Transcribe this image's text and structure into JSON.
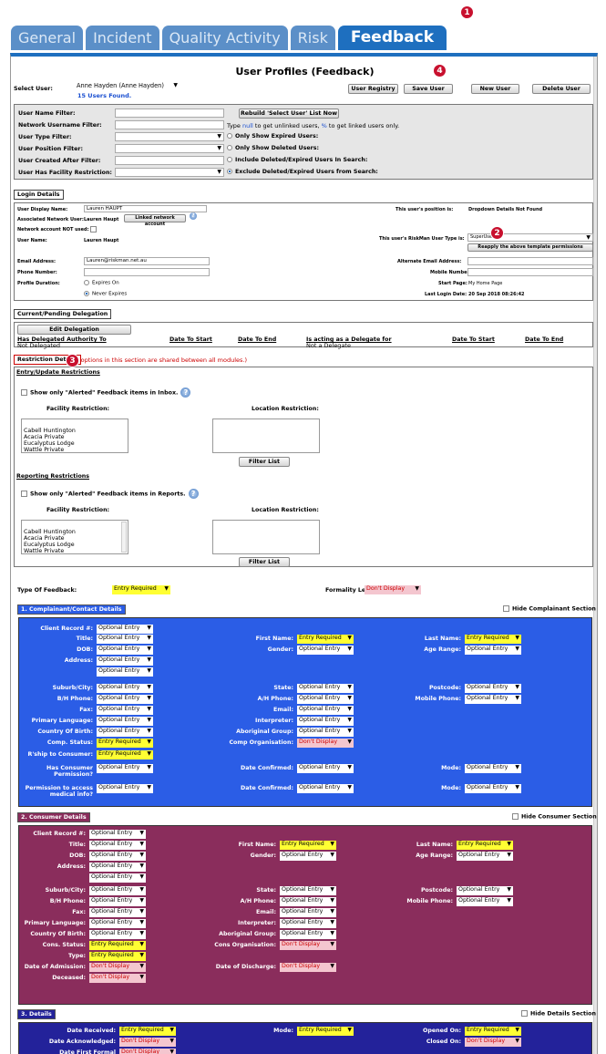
{
  "tabs": [
    {
      "label": "General"
    },
    {
      "label": "Incident"
    },
    {
      "label": "Quality Activity"
    },
    {
      "label": "Risk"
    },
    {
      "label": "Feedback"
    }
  ],
  "markers": {
    "m1": "1",
    "m2": "2",
    "m3": "3",
    "m4": "4"
  },
  "page_title": "User Profiles (Feedback)",
  "select_user": {
    "label": "Select User:",
    "value": "Anne Hayden (Anne Hayden)",
    "found": "15 Users Found."
  },
  "toolbar": {
    "registry": "User Registry",
    "save": "Save User",
    "new": "New User",
    "delete": "Delete User"
  },
  "filters": {
    "name": "User Name Filter:",
    "network": "Network Username Filter:",
    "type": "User Type Filter:",
    "position": "User Position Filter:",
    "created": "User Created After Filter:",
    "facility": "User Has Facility Restriction:",
    "rebuild": "Rebuild 'Select User' List Now",
    "hint_pre": "Type ",
    "hint_null": "null",
    "hint_mid": " to get unlinked users, ",
    "hint_pct": "%",
    "hint_post": " to get linked users only.",
    "opt1": "Only Show Expired Users:",
    "opt2": "Only Show Deleted Users:",
    "opt3": "Include Deleted/Expired Users In Search:",
    "opt4": "Exclude Deleted/Expired Users from Search:"
  },
  "login": {
    "header": "Login Details",
    "display_name": "User Display Name:",
    "display_value": "Lauren HAUPT",
    "assoc": "Associated Network User:",
    "assoc_value": "Lauren Haupt",
    "linked": "Linked network account",
    "not_used": "Network account NOT used:",
    "username": "User Name:",
    "username_value": "Lauren Haupt",
    "email": "Email Address:",
    "email_value": "Lauren@riskman.net.au",
    "phone": "Phone Number:",
    "duration": "Profile Duration:",
    "expires": "Expires On",
    "never": "Never Expires",
    "position": "This user's position is:",
    "position_value": "Dropdown Details Not Found",
    "usertype": "This user's RiskMan User Type is:",
    "usertype_value": "SuperUser",
    "reapply": "Reapply the above template permissions",
    "alt_email": "Alternate Email Address:",
    "mobile": "Mobile Number:",
    "start_page": "Start Page:",
    "start_value": "My Home Page",
    "last_login": "Last Login Date:",
    "last_value": "20 Sep 2018 08:26:42"
  },
  "delegation": {
    "header": "Current/Pending Delegation",
    "edit": "Edit Delegation",
    "h1": "Has Delegated Authority To",
    "h2": "Date To Start",
    "h3": "Date To End",
    "h4": "Is acting as a Delegate for",
    "h5": "Date To Start",
    "h6": "Date To End",
    "v1": "Not Delegated",
    "v4": "Not a Delegate"
  },
  "restriction": {
    "header": "Restriction Details",
    "note": "(All options in this section are shared between all modules.)",
    "entry": "Entry/Update Restrictions",
    "alerted_inbox": "Show only \"Alerted\" Feedback items in Inbox.",
    "facility": "Facility Restriction:",
    "location": "Location Restriction:",
    "facilities": [
      "Cabell Huntington",
      "Acacia Private",
      "Eucalyptus Lodge",
      "Wattle Private"
    ],
    "filter": "Filter List",
    "reporting": "Reporting Restrictions",
    "alerted_reports": "Show only \"Alerted\" Feedback items in Reports."
  },
  "type_feedback": {
    "label": "Type Of Feedback:",
    "value": "Entry Required",
    "formality": "Formality Level:",
    "formality_value": "Don't Display"
  },
  "section1": {
    "header": "1. Complainant/Contact Details",
    "hide": "Hide Complainant Section"
  },
  "section2": {
    "header": "2. Consumer Details",
    "hide": "Hide Consumer Section"
  },
  "section3": {
    "header": "3. Details",
    "hide": "Hide Details Section"
  },
  "opts": {
    "opt": "Optional Entry",
    "req": "Entry Required",
    "dd": "Don't Display"
  },
  "f1": {
    "client": "Client Record #:",
    "title": "Title:",
    "dob": "DOB:",
    "address": "Address:",
    "suburb": "Suburb/City:",
    "bh": "B/H Phone:",
    "fax": "Fax:",
    "lang": "Primary Language:",
    "country": "Country Of Birth:",
    "status": "Comp. Status:",
    "kship": "R'ship to Consumer:",
    "perm": "Has Consumer Permission?",
    "perm2": "Permission to access medical info?",
    "first": "First Name:",
    "gender": "Gender:",
    "state": "State:",
    "ah": "A/H Phone:",
    "email": "Email:",
    "interp": "Interpreter:",
    "abor": "Aboriginal Group:",
    "comp_org": "Comp Organisation:",
    "date_conf": "Date Confirmed:",
    "last": "Last Name:",
    "age": "Age Range:",
    "postcode": "Postcode:",
    "mobile": "Mobile Phone:",
    "mode": "Mode:"
  },
  "f2": {
    "status": "Cons. Status:",
    "type": "Type:",
    "admission": "Date of Admission:",
    "deceased": "Deceased:",
    "cons_org": "Cons Organisation:",
    "discharge": "Date of Discharge:"
  },
  "f3": {
    "received": "Date Received:",
    "ack": "Date Acknowledged:",
    "first": "Date First Formal Response:",
    "mode": "Mode:",
    "opened": "Opened On:",
    "closed": "Closed On:"
  },
  "colors": {
    "blue_panel": "#2b5de6",
    "plum_panel": "#8a2d5c",
    "navy_panel": "#23229a",
    "tab_active": "#1e6fbf"
  }
}
